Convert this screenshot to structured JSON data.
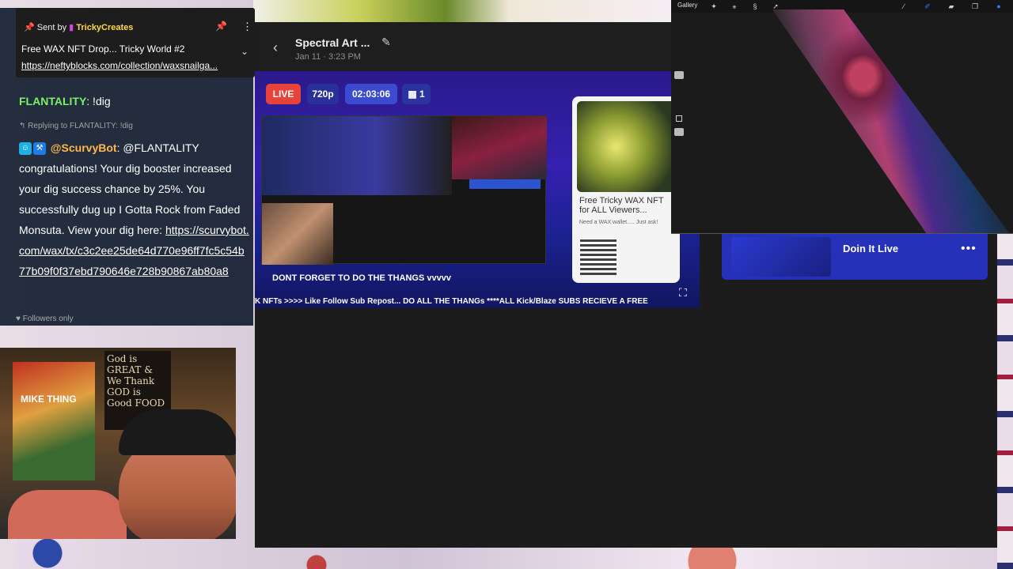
{
  "app": {
    "title": "Spectral Art ...",
    "subtitle": "Jan 11 · 3:23 PM"
  },
  "preview": {
    "live_label": "LIVE",
    "resolution": "720p",
    "duration": "02:03:06",
    "qr_count": "1",
    "promo_title": "Free Tricky WAX NFT for ALL Viewers...",
    "promo_sub": "Need a WAX wallet..... Just ask!",
    "cta": "DONT FORGET TO DO THE THANGS vvvvv",
    "ticker": "K NFTs >>>> Like Follow Sub Repost... DO ALL THE THANGs ****ALL Kick/Blaze SUBS RECIEVE A FREE"
  },
  "drawing_app": {
    "gallery_label": "Gallery"
  },
  "song": {
    "title": "Doin It Live"
  },
  "chat": {
    "pinned": {
      "sent_by_label": "Sent by",
      "sender": "TrickyCreates",
      "title": "Free WAX NFT Drop... Tricky World #2",
      "link": "https://neftyblocks.com/collection/waxsnailga..."
    },
    "message1": {
      "user": "FLANTALITY",
      "text": ": !dig"
    },
    "reply_label": "Replying to FLANTALITY: !dig",
    "message2": {
      "user": "@ScurvyBot",
      "text": ": @FLANTALITY congratulations! Your dig booster increased your dig success chance by 25%. You successfully dug up I Gotta Rock from Faded Monsuta. View your dig here:",
      "link": "https://scurvybot.com/wax/tx/c3c2ee25de64d770e96ff7fc5c54b77b09f0f37ebd790646e728b90867ab80a8"
    },
    "followers_only": "Followers only"
  },
  "webcam": {
    "sign_text": "God is GREAT & We Thank GOD is Good FOOD",
    "poster_text": "MIKE THING"
  }
}
